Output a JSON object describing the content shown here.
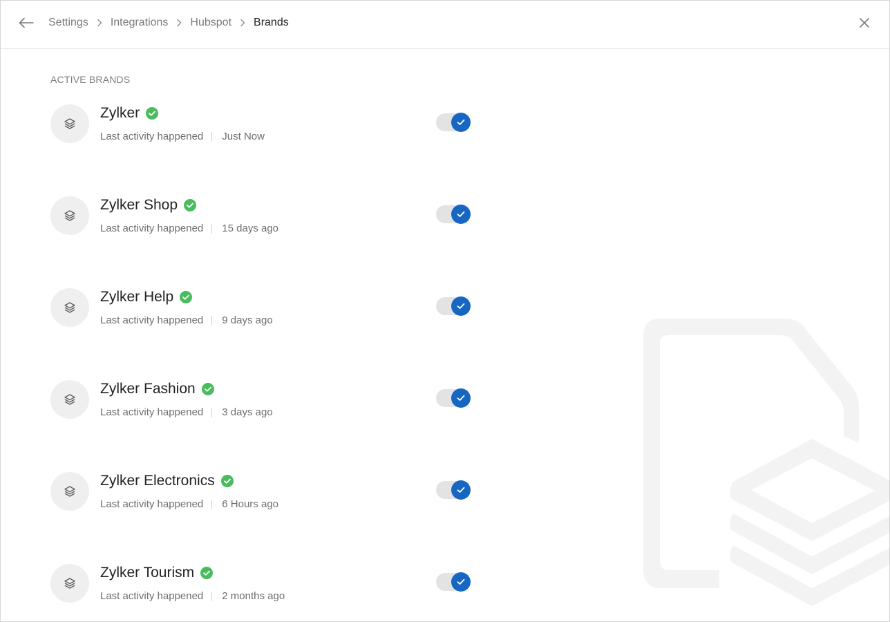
{
  "breadcrumb": {
    "items": [
      "Settings",
      "Integrations",
      "Hubspot"
    ],
    "current": "Brands"
  },
  "section_label": "ACTIVE BRANDS",
  "brands": [
    {
      "name": "Zylker",
      "meta_label": "Last activity happened",
      "last_activity": "Just Now",
      "enabled": true
    },
    {
      "name": "Zylker Shop",
      "meta_label": "Last activity happened",
      "last_activity": "15 days ago",
      "enabled": true
    },
    {
      "name": "Zylker Help",
      "meta_label": "Last activity happened",
      "last_activity": "9 days ago",
      "enabled": true
    },
    {
      "name": "Zylker Fashion",
      "meta_label": "Last activity happened",
      "last_activity": "3 days ago",
      "enabled": true
    },
    {
      "name": "Zylker Electronics",
      "meta_label": "Last activity happened",
      "last_activity": "6 Hours ago",
      "enabled": true
    },
    {
      "name": "Zylker Tourism",
      "meta_label": "Last activity happened",
      "last_activity": "2 months ago",
      "enabled": true
    }
  ],
  "icons": {
    "back": "arrow-left-icon",
    "close": "close-icon",
    "chevron": "chevron-right-icon",
    "avatar": "layers-icon",
    "verified": "check-circle-icon",
    "toggle": "check-icon"
  },
  "colors": {
    "accent": "#1767c2",
    "verified": "#4cbb5e",
    "track": "#e3e3e3"
  }
}
